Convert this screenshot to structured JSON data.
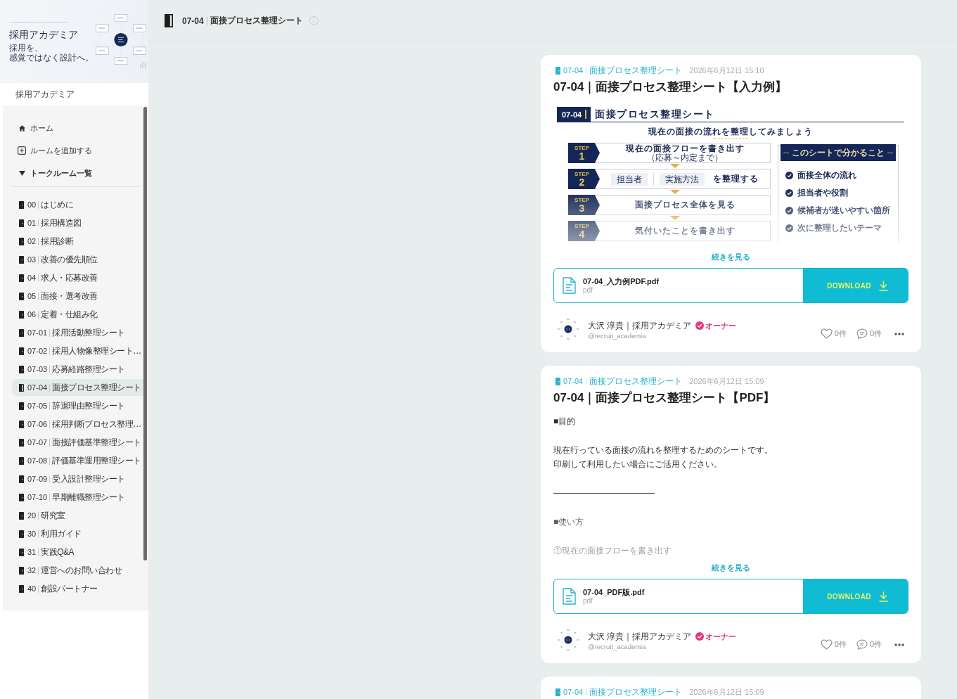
{
  "sidebar": {
    "banner": {
      "title": "採用アカデミア",
      "tagline": [
        "採用を、",
        "感覚ではなく設計へ。"
      ]
    },
    "brand": "採用アカデミア",
    "nav": [
      {
        "kind": "home",
        "label": "ホーム"
      },
      {
        "kind": "add",
        "label": "ルームを追加する"
      }
    ],
    "section": {
      "label": "トークルーム一覧",
      "expanded": true
    },
    "rooms": [
      {
        "number": "00",
        "name": "はじめに",
        "selected": false
      },
      {
        "number": "01",
        "name": "採用構造図",
        "selected": false
      },
      {
        "number": "02",
        "name": "採用診断",
        "selected": false
      },
      {
        "number": "03",
        "name": "改善の優先順位",
        "selected": false
      },
      {
        "number": "04",
        "name": "求人・応募改善",
        "selected": false
      },
      {
        "number": "05",
        "name": "面接・選考改善",
        "selected": false
      },
      {
        "number": "06",
        "name": "定着・仕組み化",
        "selected": false
      },
      {
        "number": "07-01",
        "name": "採用活動整理シート",
        "selected": false
      },
      {
        "number": "07-02",
        "name": "採用人物像整理シート…",
        "selected": false
      },
      {
        "number": "07-03",
        "name": "応募経路整理シート",
        "selected": false
      },
      {
        "number": "07-04",
        "name": "面接プロセス整理シート",
        "selected": true
      },
      {
        "number": "07-05",
        "name": "辞退理由整理シート",
        "selected": false
      },
      {
        "number": "07-06",
        "name": "採用判断プロセス整理…",
        "selected": false
      },
      {
        "number": "07-07",
        "name": "面接評価基準整理シート",
        "selected": false
      },
      {
        "number": "07-08",
        "name": "評価基準運用整理シート",
        "selected": false
      },
      {
        "number": "07-09",
        "name": "受入設計整理シート",
        "selected": false
      },
      {
        "number": "07-10",
        "name": "早期離職整理シート",
        "selected": false
      },
      {
        "number": "20",
        "name": "研究室",
        "selected": false
      },
      {
        "number": "30",
        "name": "利用ガイド",
        "selected": false
      },
      {
        "number": "31",
        "name": "実践Q&A",
        "selected": false
      },
      {
        "number": "32",
        "name": "運営へのお問い合わせ",
        "selected": false
      },
      {
        "number": "40",
        "name": "創設パートナー",
        "selected": false
      }
    ]
  },
  "header": {
    "room": {
      "number": "07-04",
      "name": "面接プロセス整理シート"
    }
  },
  "posts": [
    {
      "room": {
        "number": "07-04",
        "name": "面接プロセス整理シート"
      },
      "date": "2026年6月12日 15:10",
      "title": "07-04｜面接プロセス整理シート【入力例】",
      "kind": "sheet",
      "sheet": {
        "number": "07-04",
        "title": "面接プロセス整理シート",
        "lead": "現在の面接の流れを整理してみましょう",
        "steps": [
          {
            "label": "STEP",
            "number": "1",
            "kind": "text",
            "text": "現在の面接フローを書き出す",
            "note": "（応募～内定まで）"
          },
          {
            "label": "STEP",
            "number": "2",
            "kind": "fields",
            "fields": [
              "担当者",
              "実施方法"
            ],
            "text": "を整理する"
          },
          {
            "label": "STEP",
            "number": "3",
            "kind": "text",
            "text": "面接プロセス全体を見る"
          },
          {
            "label": "STEP",
            "number": "4",
            "kind": "text",
            "text": "気付いたことを書き出す"
          }
        ],
        "summary": {
          "title": "このシートで分かること",
          "items": [
            "面接全体の流れ",
            "担当者や役割",
            "候補者が迷いやすい箇所",
            "次に整理したいテーマ"
          ]
        }
      },
      "more": "続きを見る",
      "attachment": {
        "filename": "07-04_入力例PDF.pdf",
        "type": "pdf",
        "button": "DOWNLOAD"
      },
      "author": {
        "name": "大沢 淳貴｜採用アカデミア",
        "verified": true,
        "role": "オーナー",
        "handle": "@recruit_academia"
      },
      "likes": "0件",
      "comments": "0件"
    },
    {
      "room": {
        "number": "07-04",
        "name": "面接プロセス整理シート"
      },
      "date": "2026年6月12日 15:09",
      "title": "07-04｜面接プロセス整理シート【PDF】",
      "kind": "text",
      "body": [
        [
          "■目的"
        ],
        [
          "現在行っている面接の流れを整理するためのシートです。",
          "印刷して利用したい場合にご活用ください。"
        ],
        [
          "――――――――――――"
        ],
        [
          "■使い方"
        ],
        [
          "①現在の面接フローを書き出す"
        ]
      ],
      "more": "続きを見る",
      "attachment": {
        "filename": "07-04_PDF版.pdf",
        "type": "pdf",
        "button": "DOWNLOAD"
      },
      "author": {
        "name": "大沢 淳貴｜採用アカデミア",
        "verified": true,
        "role": "オーナー",
        "handle": "@recruit_academia"
      },
      "likes": "0件",
      "comments": "0件"
    },
    {
      "room": {
        "number": "07-04",
        "name": "面接プロセス整理シート"
      },
      "date": "2026年6月12日 15:09"
    }
  ]
}
